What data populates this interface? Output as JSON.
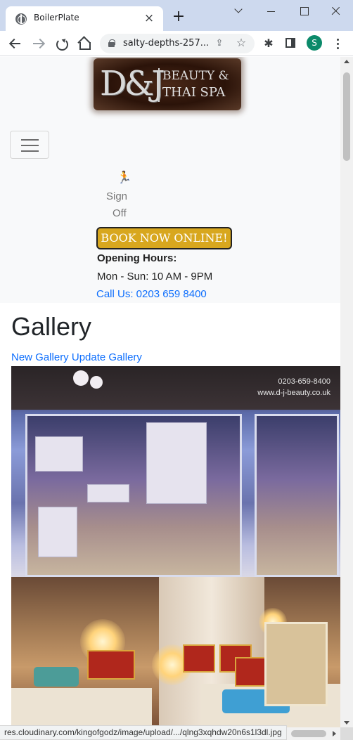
{
  "browser": {
    "tab_title": "BoilerPlate",
    "tab_close": "×",
    "new_tab": "+",
    "url": "salty-depths-257...",
    "profile_initial": "S",
    "status_url": "res.cloudinary.com/kingofgodz/image/upload/.../qlng3xqhdw20n6s1l3dl.jpg"
  },
  "header": {
    "logo": {
      "monogram": "D&J",
      "line1": "BEAUTY &",
      "line2": "THAI SPA"
    },
    "signoff_icon": "running-person-icon",
    "signoff_line1": "Sign",
    "signoff_line2": "Off",
    "book_button": "BOOK NOW ONLINE!",
    "hours_title": "Opening Hours:",
    "hours_text": "Mon - Sun: 10 AM - 9PM",
    "call_text": "Call Us: 0203 659 8400"
  },
  "gallery": {
    "title": "Gallery",
    "new_link": "New Gallery",
    "update_link": "Update Gallery",
    "photo1_text_line1": "0203-659-8400",
    "photo1_text_line2": "www.d-j-beauty.co.uk"
  },
  "colors": {
    "accent": "#d8a71e",
    "link": "#0d6efd",
    "header_bg": "#f8f9fa"
  }
}
